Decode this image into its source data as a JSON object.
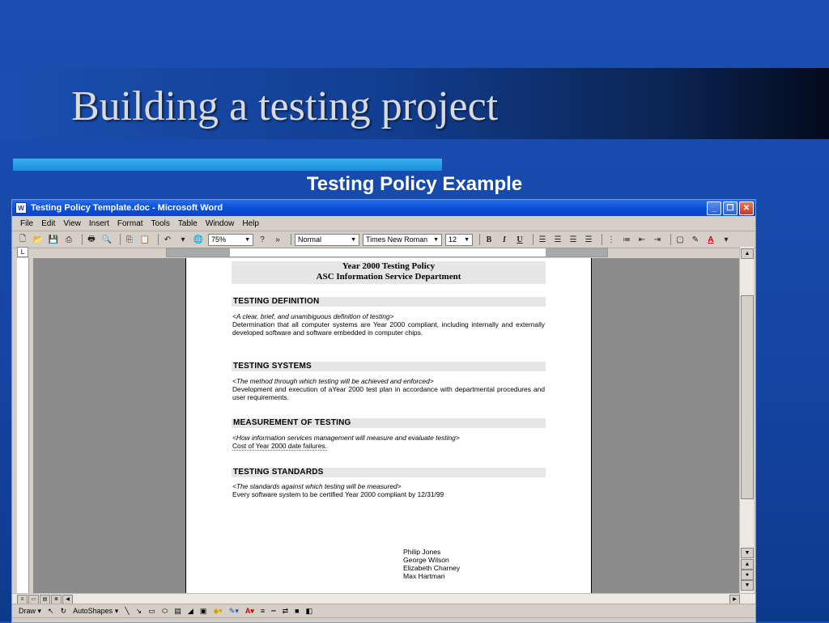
{
  "slide": {
    "title": "Building a testing project",
    "subtitle": "Testing Policy Example"
  },
  "window": {
    "title": "Testing Policy Template.doc - Microsoft Word",
    "controls": [
      "_",
      "❐",
      "✕"
    ]
  },
  "menu": [
    "File",
    "Edit",
    "View",
    "Insert",
    "Format",
    "Tools",
    "Table",
    "Window",
    "Help"
  ],
  "toolbar": {
    "zoom": "75%",
    "style": "Normal",
    "font": "Times New Roman",
    "size": "12",
    "bold": "B",
    "italic": "I",
    "underline": "U"
  },
  "document": {
    "header_line1": "Year 2000 Testing Policy",
    "header_line2": "ASC Information Service Department",
    "sections": [
      {
        "heading": "TESTING DEFINITION",
        "italic": "<A clear, brief, and unambiguous definition of testing>",
        "body": "Determination that all computer systems are Year 2000 compliant, including internally and externally developed software and software embedded in computer chips."
      },
      {
        "heading": "TESTING SYSTEMS",
        "italic": "<The method through which testing will be achieved and enforced>",
        "body": "Development and execution of aYear 2000 test plan in accordance with departmental procedures and user requirements."
      },
      {
        "heading": "MEASUREMENT OF TESTING",
        "italic": "<How information services management will measure and evaluate testing>",
        "body": "Cost of Year 2000 date failures."
      },
      {
        "heading": "TESTING STANDARDS",
        "italic": "<The standards against which testing will be measured>",
        "body": "Every software system to be certified Year 2000 compliant  by 12/31/99"
      }
    ],
    "signatories": [
      "Philip Jones",
      "George Wilson",
      "Elizabeth Charney",
      "Max Hartman"
    ]
  },
  "drawbar": {
    "draw": "Draw",
    "autoshapes": "AutoShapes"
  }
}
